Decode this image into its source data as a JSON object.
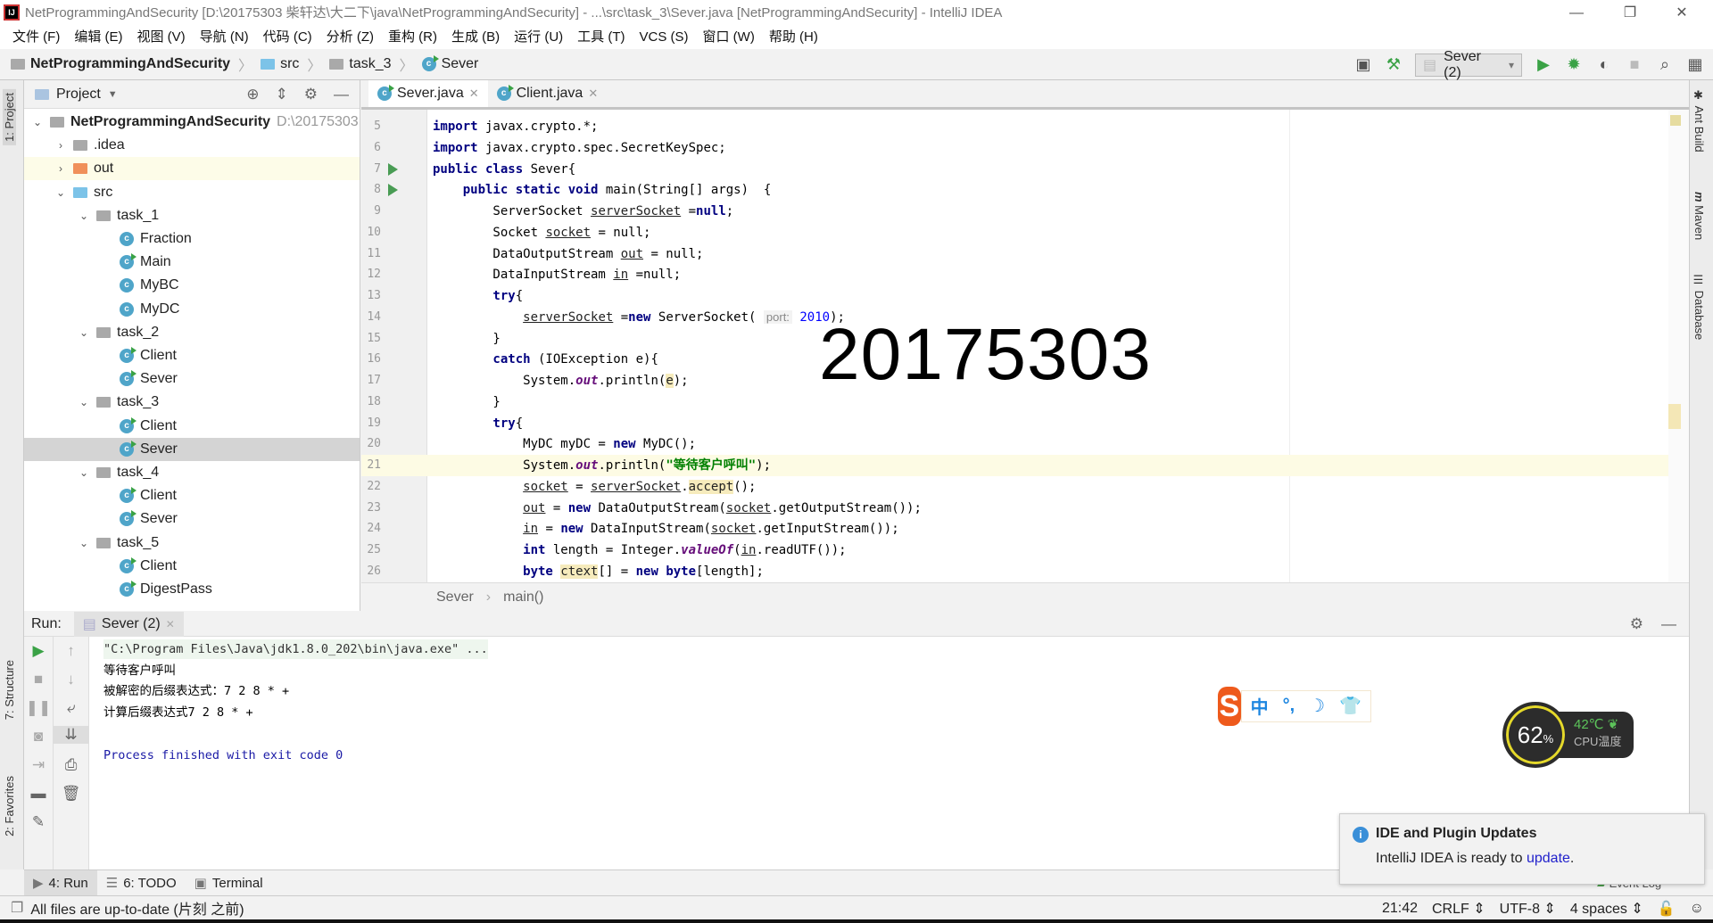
{
  "window": {
    "title": "NetProgrammingAndSecurity [D:\\20175303 柴轩达\\大二下\\java\\NetProgrammingAndSecurity] - ...\\src\\task_3\\Sever.java [NetProgrammingAndSecurity] - IntelliJ IDEA",
    "app_icon": "IJ"
  },
  "menu": [
    "文件 (F)",
    "编辑 (E)",
    "视图 (V)",
    "导航 (N)",
    "代码 (C)",
    "分析 (Z)",
    "重构 (R)",
    "生成 (B)",
    "运行 (U)",
    "工具 (T)",
    "VCS (S)",
    "窗口 (W)",
    "帮助 (H)"
  ],
  "breadcrumb": {
    "project": "NetProgrammingAndSecurity",
    "src": "src",
    "package": "task_3",
    "file": "Sever"
  },
  "toolbar": {
    "run_config": "Sever (2)"
  },
  "left_strip": {
    "project_tab": "1: Project",
    "structure_tab": "7: Structure",
    "favorites_tab": "2: Favorites"
  },
  "right_strip": {
    "ant": "Ant Build",
    "maven": "Maven",
    "database": "Database"
  },
  "project_panel": {
    "title": "Project",
    "tree": [
      {
        "label": "NetProgrammingAndSecurity",
        "path": "D:\\20175303",
        "type": "module",
        "level": 0,
        "expanded": true
      },
      {
        "label": ".idea",
        "type": "folder-grey",
        "level": 1,
        "expanded": false
      },
      {
        "label": "out",
        "type": "folder-orange",
        "level": 1,
        "expanded": false,
        "highlight": true
      },
      {
        "label": "src",
        "type": "folder-blue",
        "level": 1,
        "expanded": true
      },
      {
        "label": "task_1",
        "type": "package",
        "level": 2,
        "expanded": true
      },
      {
        "label": "Fraction",
        "type": "class",
        "level": 3
      },
      {
        "label": "Main",
        "type": "class-run",
        "level": 3
      },
      {
        "label": "MyBC",
        "type": "class",
        "level": 3
      },
      {
        "label": "MyDC",
        "type": "class",
        "level": 3
      },
      {
        "label": "task_2",
        "type": "package",
        "level": 2,
        "expanded": true
      },
      {
        "label": "Client",
        "type": "class-run",
        "level": 3
      },
      {
        "label": "Sever",
        "type": "class-run",
        "level": 3
      },
      {
        "label": "task_3",
        "type": "package",
        "level": 2,
        "expanded": true
      },
      {
        "label": "Client",
        "type": "class-run",
        "level": 3
      },
      {
        "label": "Sever",
        "type": "class-run",
        "level": 3,
        "selected": true
      },
      {
        "label": "task_4",
        "type": "package",
        "level": 2,
        "expanded": true
      },
      {
        "label": "Client",
        "type": "class-run",
        "level": 3
      },
      {
        "label": "Sever",
        "type": "class-run",
        "level": 3
      },
      {
        "label": "task_5",
        "type": "package",
        "level": 2,
        "expanded": true
      },
      {
        "label": "Client",
        "type": "class-run",
        "level": 3
      },
      {
        "label": "DigestPass",
        "type": "class-run",
        "level": 3
      }
    ]
  },
  "editor": {
    "tabs": [
      {
        "label": "Sever.java",
        "active": true
      },
      {
        "label": "Client.java",
        "active": false
      }
    ],
    "current_line": 21,
    "overlay_text": "20175303",
    "lines": [
      {
        "n": 5,
        "t": [
          [
            "import",
            "kw"
          ],
          [
            " javax.crypto.*;",
            "plain"
          ]
        ]
      },
      {
        "n": 6,
        "t": [
          [
            "import",
            "kw"
          ],
          [
            " javax.crypto.spec.SecretKeySpec;",
            "plain"
          ]
        ]
      },
      {
        "n": 7,
        "run": true,
        "t": [
          [
            "public class",
            "kw"
          ],
          [
            " Sever{",
            "plain"
          ]
        ]
      },
      {
        "n": 8,
        "run": true,
        "t": [
          [
            "    public static void",
            "kw"
          ],
          [
            " main(String[] args)  {",
            "plain"
          ]
        ]
      },
      {
        "n": 9,
        "t": [
          [
            "        ServerSocket ",
            "plain"
          ],
          [
            "serverSocket",
            "ul"
          ],
          [
            " =",
            "plain"
          ],
          [
            "null",
            "kw"
          ],
          [
            ";",
            "plain"
          ]
        ]
      },
      {
        "n": 10,
        "t": [
          [
            "        Socket ",
            "plain"
          ],
          [
            "socket",
            "ul"
          ],
          [
            " = null;",
            "plain"
          ]
        ]
      },
      {
        "n": 11,
        "t": [
          [
            "        DataOutputStream ",
            "plain"
          ],
          [
            "out",
            "ul"
          ],
          [
            " = null;",
            "plain"
          ]
        ]
      },
      {
        "n": 12,
        "t": [
          [
            "        DataInputStream ",
            "plain"
          ],
          [
            "in",
            "ul"
          ],
          [
            " =null;",
            "plain"
          ]
        ]
      },
      {
        "n": 13,
        "t": [
          [
            "        try",
            "kw"
          ],
          [
            "{",
            "plain"
          ]
        ]
      },
      {
        "n": 14,
        "t": [
          [
            "            ",
            "plain"
          ],
          [
            "serverSocket",
            "ul"
          ],
          [
            " =",
            "plain"
          ],
          [
            "new",
            "kw"
          ],
          [
            " ServerSocket( ",
            "plain"
          ],
          [
            "port:",
            "hint"
          ],
          [
            " ",
            "plain"
          ],
          [
            "2010",
            "num"
          ],
          [
            ");",
            "plain"
          ]
        ]
      },
      {
        "n": 15,
        "t": [
          [
            "        }",
            "plain"
          ]
        ]
      },
      {
        "n": 16,
        "t": [
          [
            "        catch",
            "kw"
          ],
          [
            " (IOException e){",
            "plain"
          ]
        ]
      },
      {
        "n": 17,
        "t": [
          [
            "            System.",
            "plain"
          ],
          [
            "out",
            "ital"
          ],
          [
            ".println(",
            "plain"
          ],
          [
            "e",
            "mark"
          ],
          [
            ");",
            "plain"
          ]
        ]
      },
      {
        "n": 18,
        "t": [
          [
            "        }",
            "plain"
          ]
        ]
      },
      {
        "n": 19,
        "t": [
          [
            "        try",
            "kw"
          ],
          [
            "{",
            "plain"
          ]
        ]
      },
      {
        "n": 20,
        "t": [
          [
            "            MyDC myDC = ",
            "plain"
          ],
          [
            "new",
            "kw"
          ],
          [
            " MyDC();",
            "plain"
          ]
        ]
      },
      {
        "n": 21,
        "t": [
          [
            "            System.",
            "plain"
          ],
          [
            "out",
            "ital"
          ],
          [
            ".println(",
            "plain"
          ],
          [
            "\"等待客户呼叫\"",
            "str"
          ],
          [
            ");",
            "plain"
          ]
        ]
      },
      {
        "n": 22,
        "t": [
          [
            "            ",
            "plain"
          ],
          [
            "socket",
            "ul"
          ],
          [
            " = ",
            "plain"
          ],
          [
            "serverSocket",
            "ul"
          ],
          [
            ".",
            "plain"
          ],
          [
            "accept",
            "mark"
          ],
          [
            "();",
            "plain"
          ]
        ]
      },
      {
        "n": 23,
        "t": [
          [
            "            ",
            "plain"
          ],
          [
            "out",
            "ul"
          ],
          [
            " = ",
            "plain"
          ],
          [
            "new",
            "kw"
          ],
          [
            " DataOutputStream(",
            "plain"
          ],
          [
            "socket",
            "ul"
          ],
          [
            ".getOutputStream());",
            "plain"
          ]
        ]
      },
      {
        "n": 24,
        "t": [
          [
            "            ",
            "plain"
          ],
          [
            "in",
            "ul"
          ],
          [
            " = ",
            "plain"
          ],
          [
            "new",
            "kw"
          ],
          [
            " DataInputStream(",
            "plain"
          ],
          [
            "socket",
            "ul"
          ],
          [
            ".getInputStream());",
            "plain"
          ]
        ]
      },
      {
        "n": 25,
        "t": [
          [
            "            int",
            "kw"
          ],
          [
            " length = Integer.",
            "plain"
          ],
          [
            "valueOf",
            "ital"
          ],
          [
            "(",
            "plain"
          ],
          [
            "in",
            "ul"
          ],
          [
            ".readUTF());",
            "plain"
          ]
        ]
      },
      {
        "n": 26,
        "t": [
          [
            "            byte",
            "kw"
          ],
          [
            " ",
            "plain"
          ],
          [
            "ctext",
            "mark"
          ],
          [
            "[] = ",
            "plain"
          ],
          [
            "new byte",
            "kw"
          ],
          [
            "[length];",
            "plain"
          ]
        ]
      }
    ],
    "crumbs": {
      "class": "Sever",
      "method": "main()"
    }
  },
  "run_panel": {
    "label": "Run:",
    "tab": "Sever (2)",
    "output": [
      {
        "text": "\"C:\\Program Files\\Java\\jdk1.8.0_202\\bin\\java.exe\" ...",
        "style": "cmd"
      },
      {
        "text": "等待客户呼叫",
        "style": "plain"
      },
      {
        "text": "被解密的后缀表达式：7 2 8 * +",
        "style": "plain"
      },
      {
        "text": "计算后缀表达式7 2 8 * +",
        "style": "plain"
      },
      {
        "text": "",
        "style": "plain"
      },
      {
        "text": "Process finished with exit code 0",
        "style": "blue"
      }
    ]
  },
  "bottom_tabs": [
    {
      "label": "4: Run",
      "icon": "play-icon",
      "active": true
    },
    {
      "label": "6: TODO",
      "icon": "list-icon"
    },
    {
      "label": "Terminal",
      "icon": "terminal-icon"
    }
  ],
  "status": {
    "message": "All files are up-to-date (片刻 之前)",
    "position": "21:42",
    "line_sep": "CRLF",
    "encoding": "UTF-8",
    "indent": "4 spaces",
    "event_log": "Event Log"
  },
  "notification": {
    "title": "IDE and Plugin Updates",
    "body": "IntelliJ IDEA is ready to ",
    "link": "update",
    "suffix": "."
  },
  "ime": {
    "logo": "S",
    "mode": "中",
    "punct": "°,",
    "moon": "☽",
    "skin": "👕"
  },
  "cpu_widget": {
    "usage": "62",
    "unit": "%",
    "temperature": "42℃",
    "label": "CPU温度",
    "ring_color": "#e5d92a"
  }
}
